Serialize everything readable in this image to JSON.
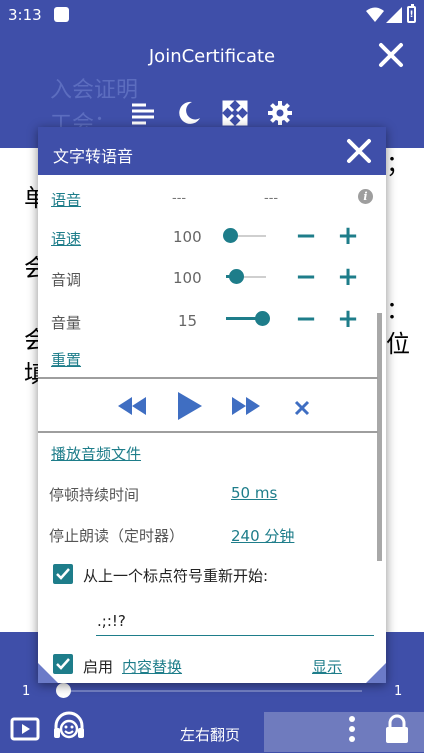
{
  "status_bar": {
    "time": "3:13"
  },
  "app_bar": {
    "title": "JoinCertificate",
    "ghost_line1": "入会证明",
    "ghost_line2": "工会："
  },
  "background_text": {
    "t1": "单",
    "t2": "会",
    "t3": "会",
    "t4": "填",
    "t5": "位",
    "t6": "；",
    "t7": "："
  },
  "dialog": {
    "title": "文字转语音",
    "voice": {
      "label": "语音",
      "value1": "---",
      "value2": "---"
    },
    "speed": {
      "label": "语速",
      "value": "100",
      "level": 0.1
    },
    "pitch": {
      "label": "音调",
      "value": "100",
      "level": 0.25
    },
    "volume": {
      "label": "音量",
      "value": "15",
      "level": 0.9
    },
    "reset_label": "重置",
    "play_file_label": "播放音频文件",
    "pause_duration": {
      "label": "停顿持续时间",
      "value": "50 ms"
    },
    "stop_timer": {
      "label": "停止朗读（定时器）",
      "value": "240 分钟"
    },
    "restart_option": {
      "label": "从上一个标点符号重新开始:",
      "checked": true
    },
    "punctuation_value": ".;:!?",
    "replace_option": {
      "enable_label": "启用",
      "link_label": "内容替换",
      "show_label": "显示",
      "checked": true
    }
  },
  "bottom_bar": {
    "page_start": "1",
    "page_end": "1",
    "progress": 0.0,
    "turn_label": "左右翻页"
  },
  "colors": {
    "primary": "#3f4fa9",
    "accent": "#1e7d8a"
  }
}
